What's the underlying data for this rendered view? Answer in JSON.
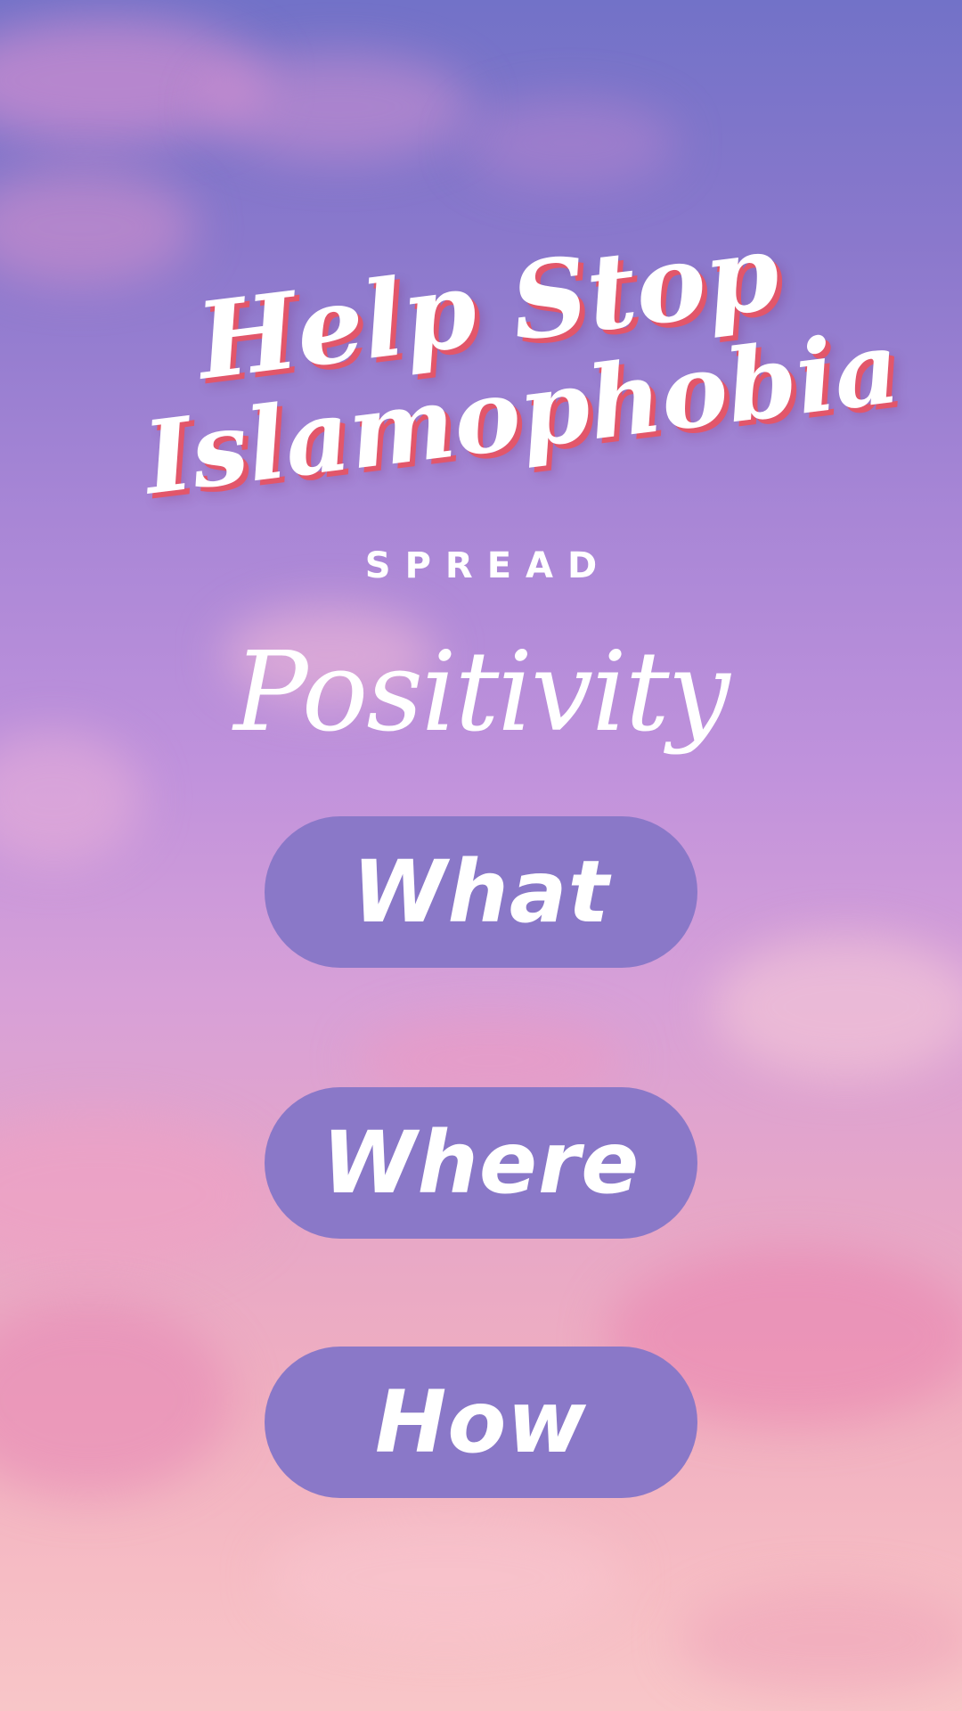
{
  "title": {
    "line1": "Help Stop",
    "line2": "Islamophobia"
  },
  "spread_label": "SPREAD",
  "positivity_label": "Positivity",
  "buttons": [
    {
      "label": "What"
    },
    {
      "label": "Where"
    },
    {
      "label": "How"
    }
  ],
  "colors": {
    "sky_top": "#7272c8",
    "sky_bottom": "#f8c6c8",
    "button_fill": "#8a78c8",
    "text": "#ffffff",
    "title_shadow": "#e2566a"
  }
}
